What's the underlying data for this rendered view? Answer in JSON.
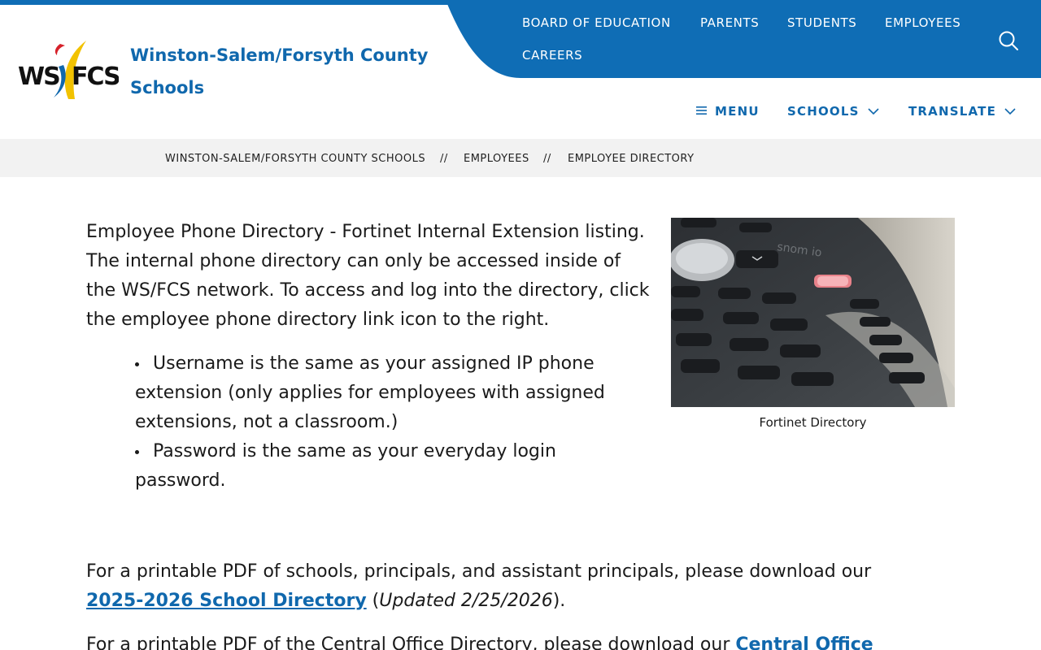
{
  "header": {
    "site_title": "Winston-Salem/Forsyth County Schools",
    "logo_text": "WS/FCS",
    "top_nav": [
      "BOARD OF EDUCATION",
      "PARENTS",
      "STUDENTS",
      "EMPLOYEES",
      "CAREERS"
    ],
    "secondary_nav": {
      "menu": "MENU",
      "schools": "SCHOOLS",
      "translate": "TRANSLATE"
    },
    "colors": {
      "brand_blue": "#0f6db5",
      "title_blue": "#1068ad",
      "logo_yellow": "#f2c200",
      "logo_red": "#d6212a"
    }
  },
  "breadcrumb": [
    "WINSTON-SALEM/FORSYTH COUNTY SCHOOLS",
    "//",
    "EMPLOYEES",
    "//",
    "EMPLOYEE DIRECTORY"
  ],
  "main": {
    "intro": "Employee Phone Directory - Fortinet Internal Extension listing. The internal phone directory can only be accessed inside of the WS/FCS network. To access and log into the directory, click the employee phone directory link icon to the right.",
    "bullets": [
      "Username is the same as your assigned IP phone extension (only applies for employees with assigned extensions, not a classroom.)",
      "Password is the same as your everyday login password."
    ],
    "pdf_paragraph": {
      "prefix": "For a printable PDF of schools, principals, and assistant principals, please download our ",
      "link": "2025-2026 School Directory",
      "open_paren": " (",
      "updated": "Updated 2/25/2026",
      "close": ")."
    },
    "central_paragraph": {
      "prefix": "For a printable PDF of the Central Office Directory, please download our ",
      "link": "Central Office"
    }
  },
  "figure": {
    "caption": "Fortinet Directory",
    "phone_brand_text": "snom io"
  }
}
